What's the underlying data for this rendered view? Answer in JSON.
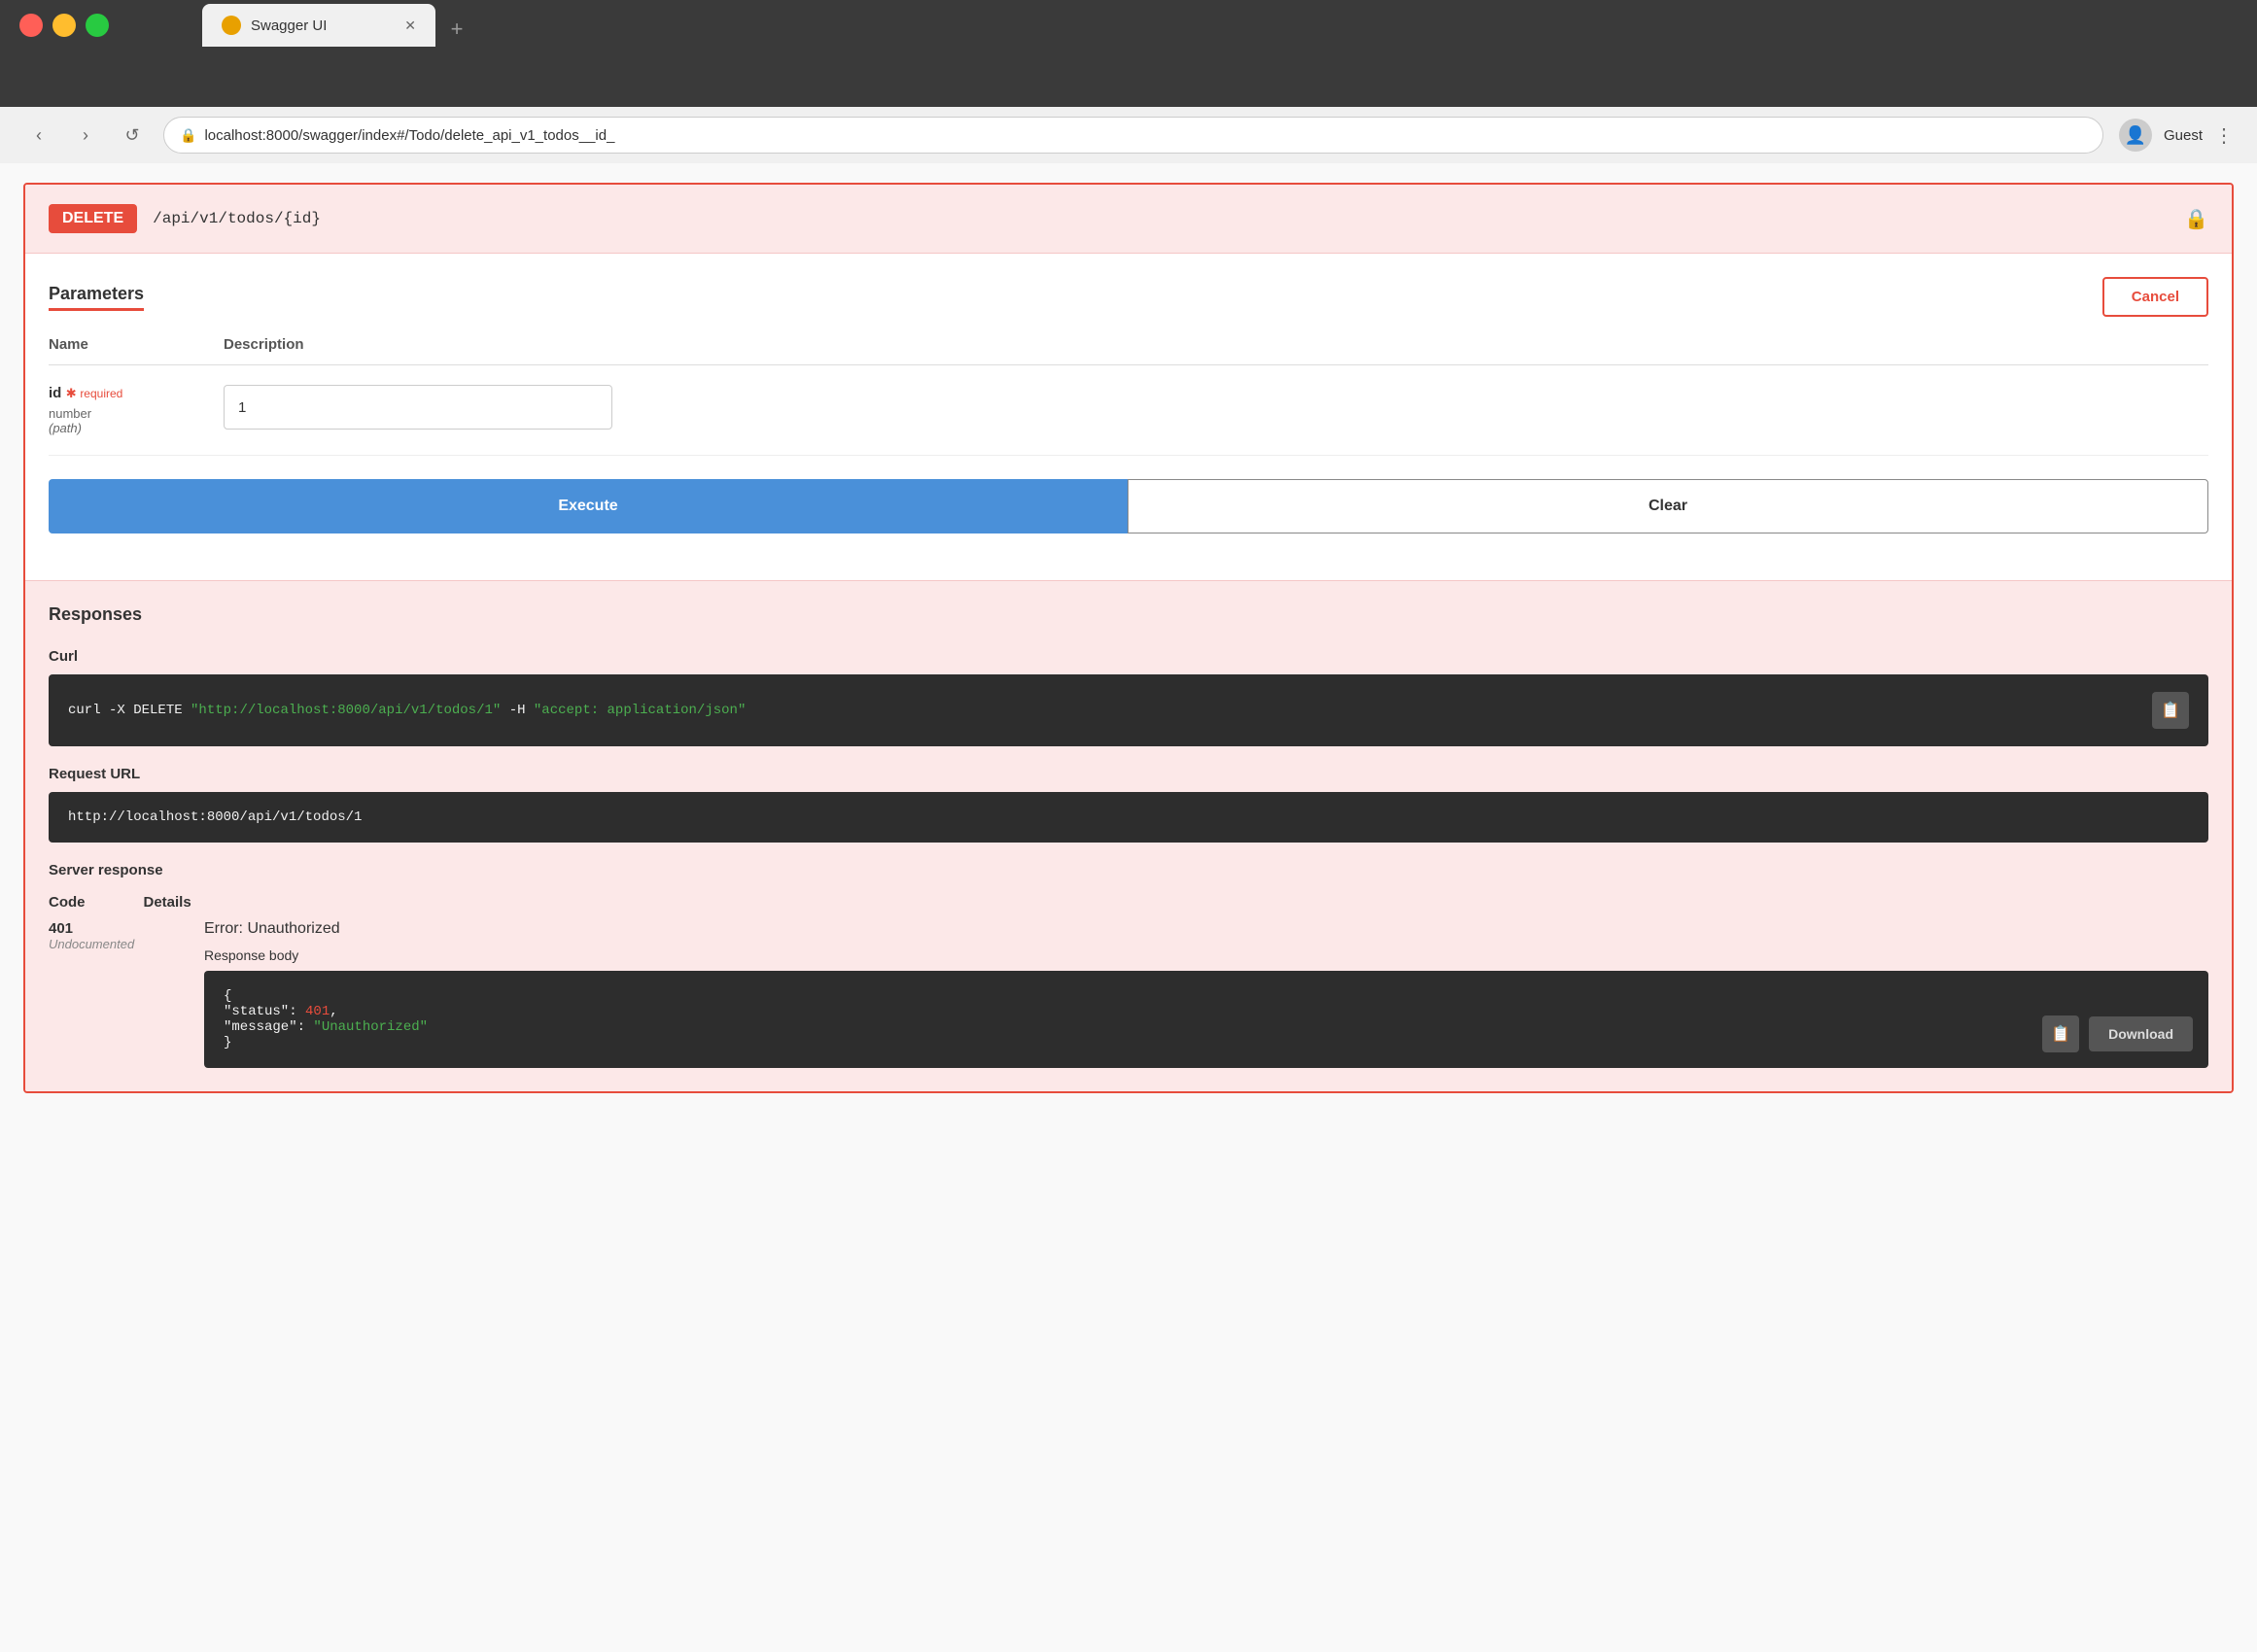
{
  "browser": {
    "tab_title": "Swagger UI",
    "tab_favicon": "S",
    "address": "localhost:8000/swagger/index#/Todo/delete_api_v1_todos__id_",
    "new_tab_label": "+",
    "nav_back": "‹",
    "nav_forward": "›",
    "nav_refresh": "↺",
    "user_label": "Guest",
    "menu_icon": "⋮"
  },
  "panel": {
    "method": "DELETE",
    "path": "/api/v1/todos/{id}",
    "lock_icon": "🔒"
  },
  "parameters": {
    "title": "Parameters",
    "cancel_label": "Cancel",
    "col_name": "Name",
    "col_description": "Description",
    "param_name": "id",
    "required_star": "★",
    "required_label": "required",
    "param_type": "number",
    "param_location": "(path)",
    "param_value": "1"
  },
  "actions": {
    "execute_label": "Execute",
    "clear_label": "Clear"
  },
  "responses": {
    "title": "Responses",
    "curl_label": "Curl",
    "curl_text": "curl -X DELETE ",
    "curl_url": "\"http://localhost:8000/api/v1/todos/1\"",
    "curl_flag": " -H ",
    "curl_header": "\"accept: application/json\"",
    "request_url_label": "Request URL",
    "request_url": "http://localhost:8000/api/v1/todos/1",
    "server_response_label": "Server response",
    "code_col_header": "Code",
    "details_col_header": "Details",
    "response_code": "401",
    "response_undoc": "Undocumented",
    "error_title": "Error: Unauthorized",
    "response_body_label": "Response body",
    "json_line1": "{",
    "json_status_key": "  \"status\": ",
    "json_status_val": "401",
    "json_message_key": "  \"message\": ",
    "json_message_val": "\"Unauthorized\"",
    "json_line_end": "}",
    "download_label": "Download"
  }
}
